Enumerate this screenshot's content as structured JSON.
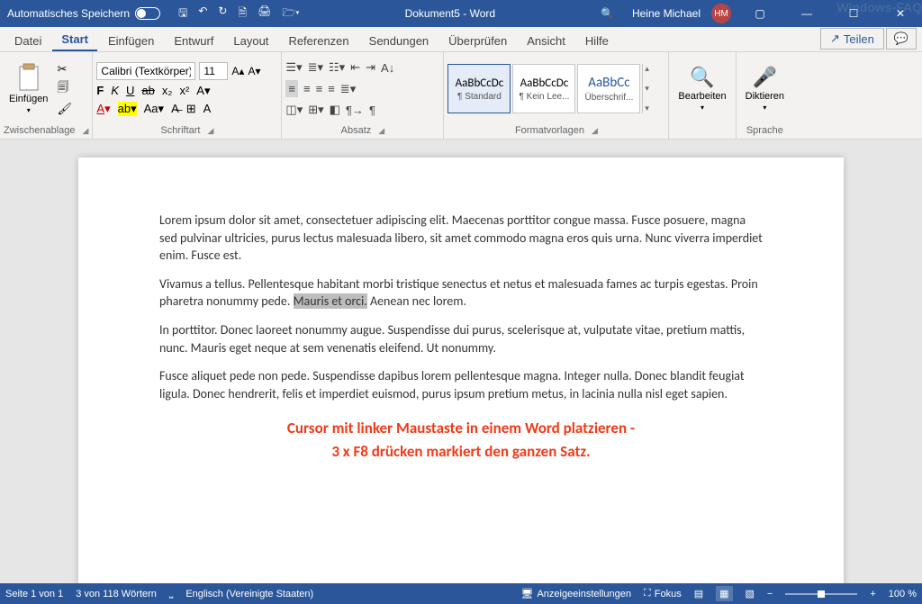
{
  "titlebar": {
    "autosave": "Automatisches Speichern",
    "doc_title": "Dokument5 - Word",
    "user": "Heine Michael",
    "initials": "HM"
  },
  "watermark": "Windows-FAQ",
  "tabs": {
    "file": "Datei",
    "home": "Start",
    "insert": "Einfügen",
    "draw": "Entwurf",
    "layout": "Layout",
    "references": "Referenzen",
    "mailings": "Sendungen",
    "review": "Überprüfen",
    "view": "Ansicht",
    "help": "Hilfe",
    "share": "Teilen"
  },
  "ribbon": {
    "clipboard": {
      "paste": "Einfügen",
      "label": "Zwischenablage"
    },
    "font": {
      "name": "Calibri (Textkörper)",
      "size": "11",
      "buttons": {
        "bold": "F",
        "italic": "K",
        "underline": "U"
      },
      "label": "Schriftart"
    },
    "paragraph": {
      "label": "Absatz"
    },
    "styles": {
      "s1": {
        "preview": "AaBbCcDc",
        "name": "¶ Standard"
      },
      "s2": {
        "preview": "AaBbCcDc",
        "name": "¶ Kein Lee..."
      },
      "s3": {
        "preview": "AaBbCc",
        "name": "Überschrif..."
      },
      "label": "Formatvorlagen"
    },
    "editing": {
      "label": "Bearbeiten"
    },
    "voice": {
      "dictate": "Diktieren",
      "label": "Sprache"
    }
  },
  "document": {
    "p1": "Lorem ipsum dolor sit amet, consectetuer adipiscing elit. Maecenas porttitor congue massa. Fusce posuere, magna sed pulvinar ultricies, purus lectus malesuada libero, sit amet commodo magna eros quis urna. Nunc viverra imperdiet enim. Fusce est.",
    "p2a": "Vivamus a tellus. Pellentesque habitant morbi tristique senectus et netus et malesuada fames ac turpis egestas. Proin pharetra nonummy pede. ",
    "p2_sel": "Mauris et orci.",
    "p2b": " Aenean nec lorem.",
    "p3": "In porttitor. Donec laoreet nonummy augue. Suspendisse dui purus, scelerisque at, vulputate vitae, pretium mattis, nunc. Mauris eget neque at sem venenatis eleifend. Ut nonummy.",
    "p4": "Fusce aliquet pede non pede. Suspendisse dapibus lorem pellentesque magna. Integer nulla. Donec blandit feugiat ligula. Donec hendrerit, felis et imperdiet euismod, purus ipsum pretium metus, in lacinia nulla nisl eget sapien.",
    "anno1": "Cursor mit linker Maustaste in einem Word platzieren -",
    "anno2": "3 x F8 drücken markiert den ganzen Satz."
  },
  "status": {
    "page": "Seite 1 von 1",
    "words": "3 von 118 Wörtern",
    "lang": "Englisch (Vereinigte Staaten)",
    "display": "Anzeigeeinstellungen",
    "focus": "Fokus",
    "zoom": "100 %"
  }
}
